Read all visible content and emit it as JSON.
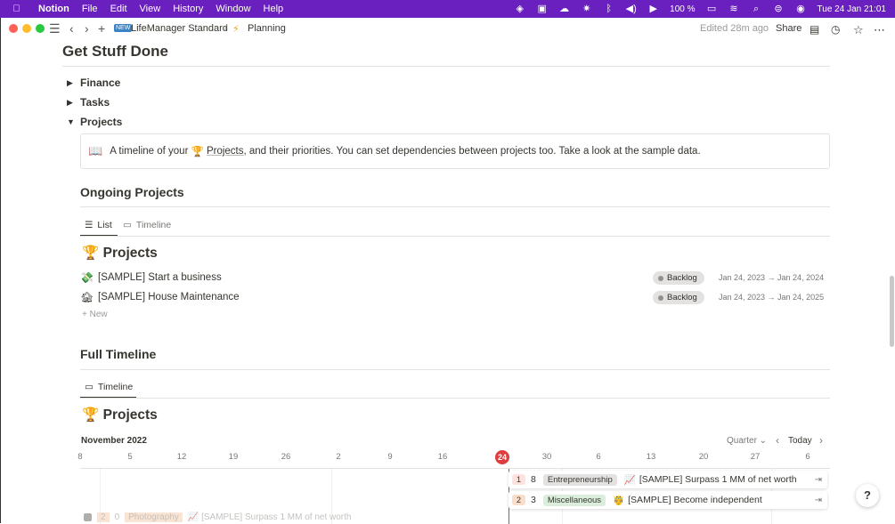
{
  "menubar": {
    "app": "Notion",
    "items": [
      "File",
      "Edit",
      "View",
      "History",
      "Window",
      "Help"
    ],
    "battery": "100 %",
    "clock": "Tue 24 Jan  21:01"
  },
  "titlebar": {
    "workspace": "LifeManager Standard",
    "separator": "/",
    "page": "Planning",
    "edited": "Edited 28m ago",
    "share": "Share"
  },
  "page": {
    "title": "Get Stuff Done",
    "toggles": [
      "Finance",
      "Tasks",
      "Projects"
    ]
  },
  "callout": {
    "icon": "📖",
    "text_before": "A timeline of your",
    "link_icon": "🏆",
    "link": "Projects",
    "text_after": ", and their priorities. You can set dependencies between projects too. Take a look at the sample data."
  },
  "ongoing": {
    "heading": "Ongoing Projects",
    "tabs": [
      "List",
      "Timeline"
    ],
    "db_title": "🏆 Projects",
    "rows": [
      {
        "emoji": "💸",
        "title": "[SAMPLE] Start a business",
        "status": "Backlog",
        "dates": "Jan 24, 2023 → Jan 24, 2024"
      },
      {
        "emoji": "🏚",
        "title": "[SAMPLE] House Maintenance",
        "status": "Backlog",
        "dates": "Jan 24, 2023 → Jan 24, 2025"
      }
    ],
    "new_label": "+  New"
  },
  "full": {
    "heading": "Full Timeline",
    "tab": "Timeline",
    "db_title": "🏆 Projects",
    "month": "November 2022",
    "range": "Quarter ⌄",
    "today": "Today",
    "ticks": [
      "8",
      "5",
      "12",
      "19",
      "26",
      "2",
      "9",
      "16",
      "24",
      "30",
      "6",
      "13",
      "20",
      "27",
      "6"
    ],
    "bars": [
      {
        "priority": "1",
        "num": "8",
        "category": "Entrepreneurship",
        "icon": "📈",
        "title": "[SAMPLE] Surpass 1 MM of net worth"
      },
      {
        "priority": "2",
        "num": "3",
        "category": "Miscellaneous",
        "icon": "🤴",
        "title": "[SAMPLE] Become independent"
      }
    ],
    "ghost": {
      "priority": "2",
      "num": "0",
      "category": "Photography",
      "title": "📈 [SAMPLE] Surpass 1 MM of net worth"
    }
  },
  "help": "?",
  "colors": {
    "menubar": "#6a1fbf",
    "today": "#e03e3e",
    "cat_gray": "#e3e2e0",
    "cat_green": "#dbeddb",
    "prio_red": "#ffe2dd",
    "prio_orange": "#fadec9"
  }
}
